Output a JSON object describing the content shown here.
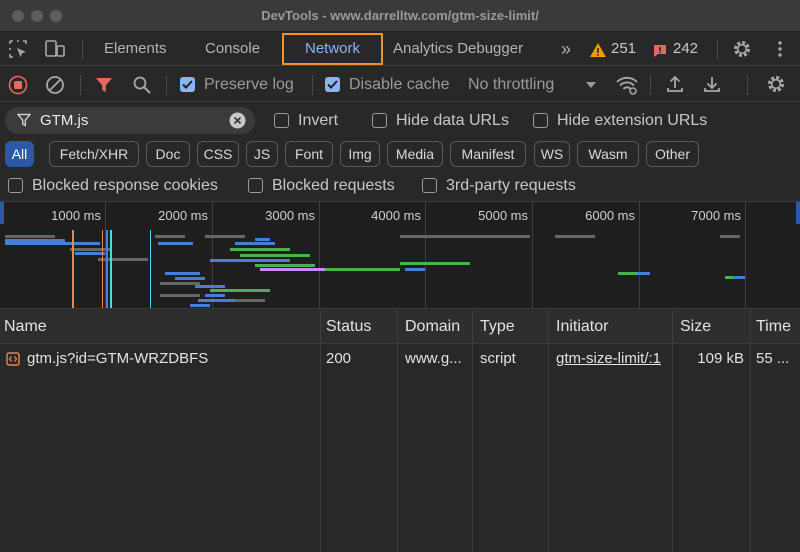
{
  "window": {
    "title": "DevTools - www.darrelltw.com/gtm-size-limit/"
  },
  "tabs": {
    "elements": "Elements",
    "console": "Console",
    "network": "Network",
    "analytics": "Analytics Debugger",
    "more": "»"
  },
  "badges": {
    "warnings": "251",
    "messages": "242"
  },
  "toolbar": {
    "preserve_log": "Preserve log",
    "disable_cache": "Disable cache",
    "throttling": "No throttling"
  },
  "filter": {
    "value": "GTM.js",
    "invert": "Invert",
    "hide_data_urls": "Hide data URLs",
    "hide_extension_urls": "Hide extension URLs"
  },
  "types": [
    "All",
    "Fetch/XHR",
    "Doc",
    "CSS",
    "JS",
    "Font",
    "Img",
    "Media",
    "Manifest",
    "WS",
    "Wasm",
    "Other"
  ],
  "blocked": {
    "response_cookies": "Blocked response cookies",
    "requests": "Blocked requests",
    "third_party": "3rd-party requests"
  },
  "timeline": {
    "ticks": [
      "1000 ms",
      "2000 ms",
      "3000 ms",
      "4000 ms",
      "5000 ms",
      "6000 ms",
      "7000 ms"
    ]
  },
  "table": {
    "headers": {
      "name": "Name",
      "status": "Status",
      "domain": "Domain",
      "type": "Type",
      "initiator": "Initiator",
      "size": "Size",
      "time": "Time"
    },
    "rows": [
      {
        "name": "gtm.js?id=GTM-WRZDBFS",
        "status": "200",
        "domain": "www.g...",
        "type": "script",
        "initiator": "gtm-size-limit/:1",
        "size": "109 kB",
        "time": "55 ..."
      }
    ]
  },
  "colors": {
    "accent": "#8ab4f8",
    "active_tab_border": "#f0922e",
    "chip_active": "#2b58a7",
    "record_red": "#e46962"
  }
}
